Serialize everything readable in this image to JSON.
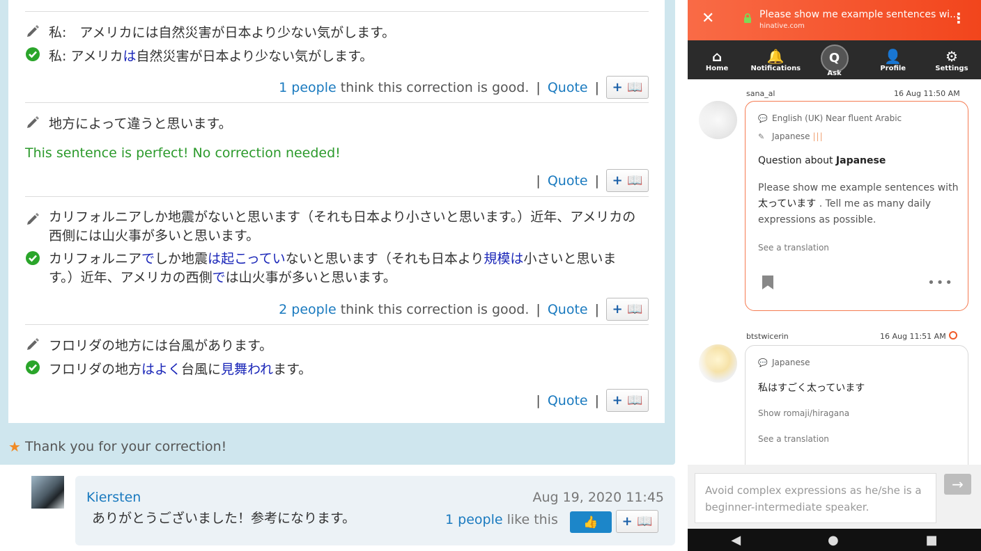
{
  "corrections": {
    "rows": [
      {
        "original": "私:　アメリカには自然災害が日本より少ない気がします。",
        "corrected_parts": [
          {
            "t": "私: アメリカ",
            "hl": false
          },
          {
            "t": "は",
            "hl": true
          },
          {
            "t": "自然災害が日本より少ない気がします。",
            "hl": false
          }
        ],
        "people_count": "1 people",
        "think_text": "think this correction is good.",
        "quote": "Quote"
      },
      {
        "original": "地方によって違うと思います。",
        "perfect_text": "This sentence is perfect! No correction needed!",
        "quote": "Quote"
      },
      {
        "original": "カリフォルニアしか地震がないと思います（それも日本より小さいと思います。）近年、アメリカの西側には山火事が多いと思います。",
        "corrected_parts": [
          {
            "t": "カリフォルニア",
            "hl": false
          },
          {
            "t": "で",
            "hl": true
          },
          {
            "t": "しか地震",
            "hl": false
          },
          {
            "t": "は",
            "hl": true
          },
          {
            "t": "起こってい",
            "hl": true
          },
          {
            "t": "ないと思います（それも日本より",
            "hl": false
          },
          {
            "t": "規模は",
            "hl": true
          },
          {
            "t": "小さいと思います。）近年、アメリカの西側",
            "hl": false
          },
          {
            "t": "で",
            "hl": true
          },
          {
            "t": "は山火事が多いと思います。",
            "hl": false
          }
        ],
        "people_count": "2 people",
        "think_text": "think this correction is good.",
        "quote": "Quote"
      },
      {
        "original": "フロリダの地方には台風があります。",
        "corrected_parts": [
          {
            "t": "フロリダの地方",
            "hl": false
          },
          {
            "t": "はよく",
            "hl": true
          },
          {
            "t": "台風に",
            "hl": false
          },
          {
            "t": "見舞われ",
            "hl": true
          },
          {
            "t": "ます。",
            "hl": false
          }
        ],
        "quote": "Quote"
      }
    ],
    "add_button_label": "+ 📖"
  },
  "thanks_text": "Thank you for your correction!",
  "comment": {
    "author": "Kiersten",
    "date": "Aug 19, 2020 11:45",
    "message": "ありがとうございました！参考になります。",
    "like_count": "1 people",
    "like_text": "like this"
  },
  "phone": {
    "title": "Please show me example sentences wi...",
    "url": "hinative.com",
    "nav": [
      "Home",
      "Notifications",
      "Ask",
      "Profile",
      "Settings"
    ],
    "question1": {
      "user": "sana_al",
      "date": "16 Aug 11:50 AM",
      "languages": "English (UK) Near fluent   Arabic",
      "learning": "Japanese",
      "title_prefix": "Question about ",
      "title_lang": "Japanese",
      "body_prefix": "Please show me example sentences with",
      "body_jp": "太っています",
      "body_suffix": ". Tell me as many daily expressions as possible.",
      "see_translation": "See a translation"
    },
    "question2": {
      "user": "btstwicerin",
      "date": "16 Aug 11:51 AM",
      "language": "Japanese",
      "sentence": "私はすごく太っています",
      "show_romaji": "Show romaji/hiragana",
      "see_translation": "See a translation"
    },
    "answer_placeholder": "Avoid complex expressions as he/she is a beginner-intermediate speaker."
  },
  "colors": {
    "link_blue": "#1a7abf",
    "highlight_blue": "#1a26b8",
    "perfect_green": "#2c9a2c",
    "hinative_orange": "#f2451c"
  }
}
